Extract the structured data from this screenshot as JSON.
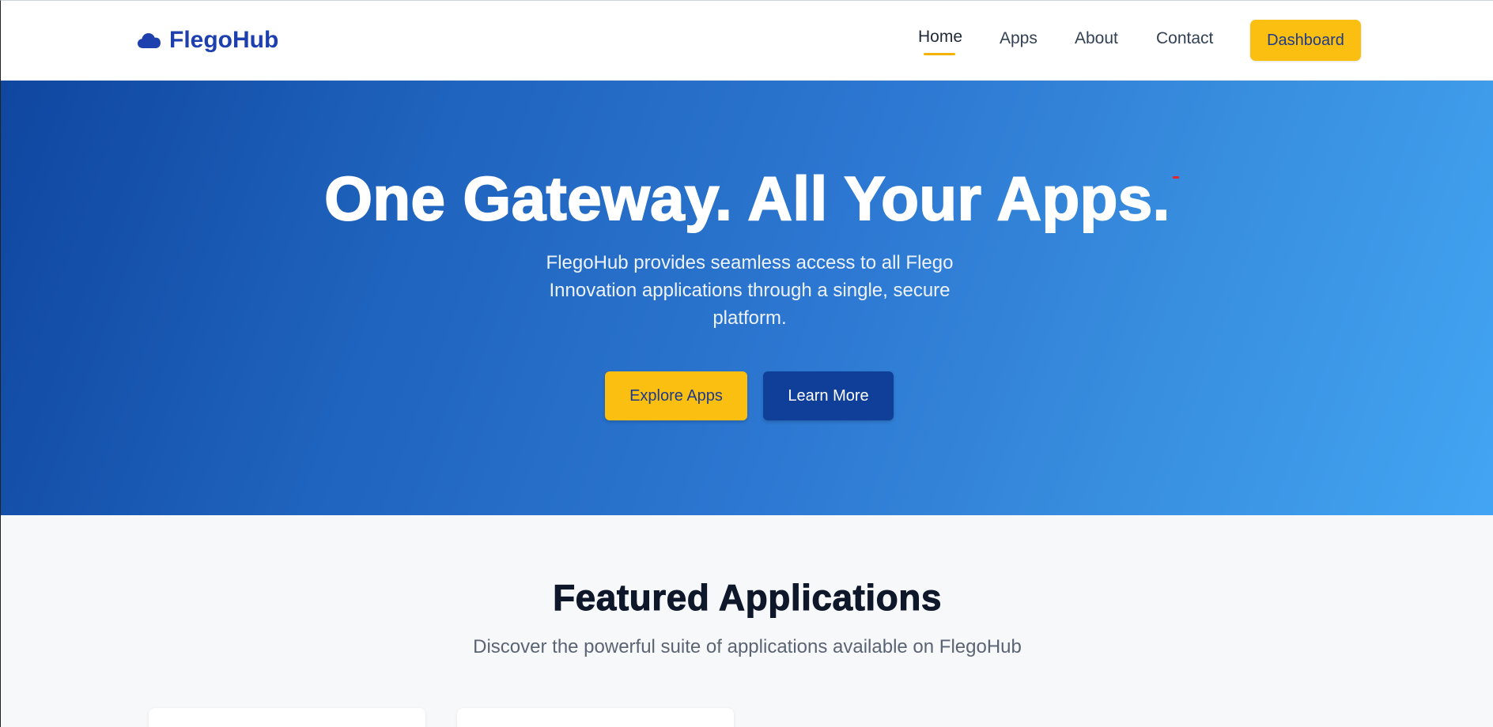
{
  "header": {
    "brand": "FlegoHub",
    "brand_icon": "cloud-icon",
    "nav": [
      {
        "label": "Home",
        "active": true
      },
      {
        "label": "Apps",
        "active": false
      },
      {
        "label": "About",
        "active": false
      },
      {
        "label": "Contact",
        "active": false
      }
    ],
    "dashboard_label": "Dashboard"
  },
  "hero": {
    "title": "One Gateway. All Your Apps.",
    "subtitle": "FlegoHub provides seamless access to all Flego Innovation applications through a single, secure platform.",
    "primary_button": "Explore Apps",
    "secondary_button": "Learn More"
  },
  "featured": {
    "title": "Featured Applications",
    "subtitle": "Discover the powerful suite of applications available on FlegoHub"
  },
  "colors": {
    "brand": "#1e40af",
    "accent": "#fbbf11",
    "hero_start": "#0f46a0",
    "hero_end": "#42a5f3",
    "secondary_button": "#0f3f99"
  }
}
